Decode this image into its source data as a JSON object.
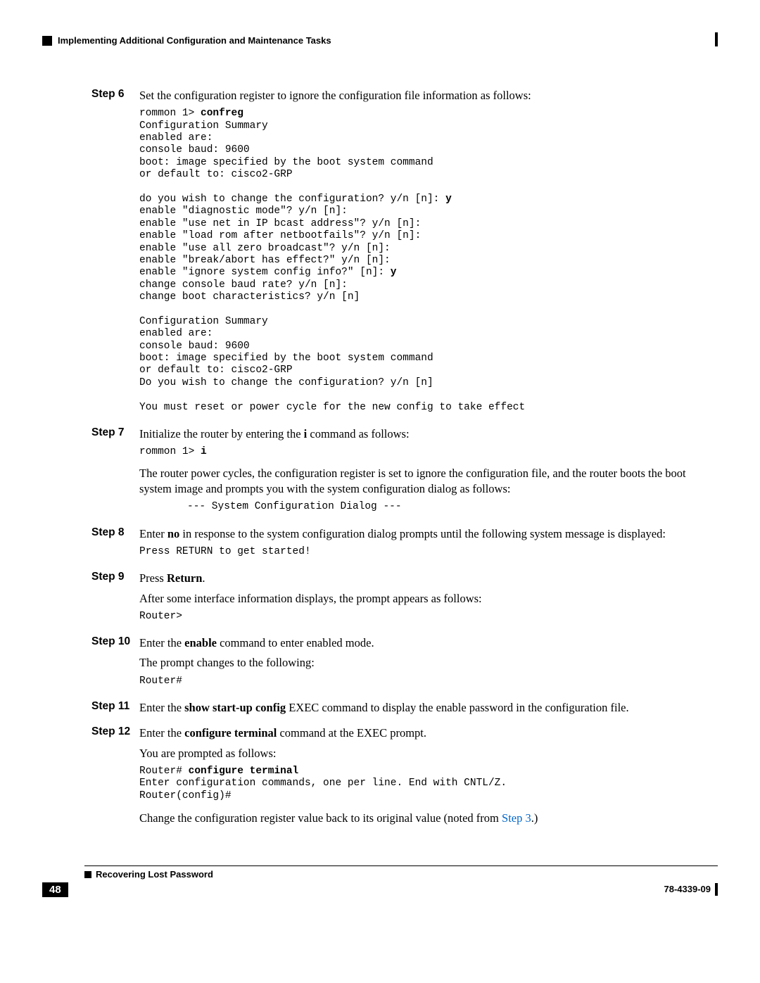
{
  "header": {
    "title": "Implementing Additional Configuration and Maintenance Tasks"
  },
  "steps": {
    "s6": {
      "label": "Step 6",
      "text": "Set the configuration register to ignore the configuration file information as follows:",
      "code_prefix": "rommon 1> ",
      "code_cmd": "confreg",
      "code_body": "Configuration Summary\nenabled are:\nconsole baud: 9600\nboot: image specified by the boot system command\nor default to: cisco2-GRP\n\ndo you wish to change the configuration? y/n [n]: ",
      "code_y1": "y",
      "code_body2": "\nenable \"diagnostic mode\"? y/n [n]:\nenable \"use net in IP bcast address\"? y/n [n]:\nenable \"load rom after netbootfails\"? y/n [n]:\nenable \"use all zero broadcast\"? y/n [n]:\nenable \"break/abort has effect?\" y/n [n]:\nenable \"ignore system config info?\" [n]: ",
      "code_y2": "y",
      "code_body3": "\nchange console baud rate? y/n [n]:\nchange boot characteristics? y/n [n]\n\nConfiguration Summary\nenabled are:\nconsole baud: 9600\nboot: image specified by the boot system command\nor default to: cisco2-GRP\nDo you wish to change the configuration? y/n [n]\n\nYou must reset or power cycle for the new config to take effect"
    },
    "s7": {
      "label": "Step 7",
      "text_pre": "Initialize the router by entering the ",
      "text_cmd": "i",
      "text_post": " command as follows:",
      "code_prefix": "rommon 1> ",
      "code_cmd": "i",
      "para2": "The router power cycles, the configuration register is set to ignore the configuration file, and the router boots the boot system image and prompts you with the system configuration dialog as follows:",
      "code2": "--- System Configuration Dialog ---"
    },
    "s8": {
      "label": "Step 8",
      "text_pre": "Enter ",
      "text_cmd": "no",
      "text_post": " in response to the system configuration dialog prompts until the following system message is displayed:",
      "code": "Press RETURN to get started!"
    },
    "s9": {
      "label": "Step 9",
      "text_pre": "Press ",
      "text_cmd": "Return",
      "text_post": ".",
      "para2": "After some interface information displays, the prompt appears as follows:",
      "code": "Router>"
    },
    "s10": {
      "label": "Step 10",
      "text_pre": "Enter the ",
      "text_cmd": "enable",
      "text_post": " command to enter enabled mode.",
      "para2": "The prompt changes to the following:",
      "code": "Router#"
    },
    "s11": {
      "label": "Step 11",
      "text_pre": "Enter the ",
      "text_cmd": "show start-up config",
      "text_post": " EXEC command to display the enable password in the configuration file."
    },
    "s12": {
      "label": "Step 12",
      "text_pre": "Enter the ",
      "text_cmd": "configure terminal",
      "text_post": " command at the EXEC prompt.",
      "para2": "You are prompted as follows:",
      "code_prefix": "Router# ",
      "code_cmd": "configure terminal",
      "code_body": "\nEnter configuration commands, one per line. End with CNTL/Z.\nRouter(config)#",
      "para3_pre": "Change the configuration register value back to its original value (noted from ",
      "para3_link": "Step 3",
      "para3_post": ".)"
    }
  },
  "footer": {
    "title": "Recovering Lost Password",
    "page": "48",
    "docnum": "78-4339-09"
  }
}
